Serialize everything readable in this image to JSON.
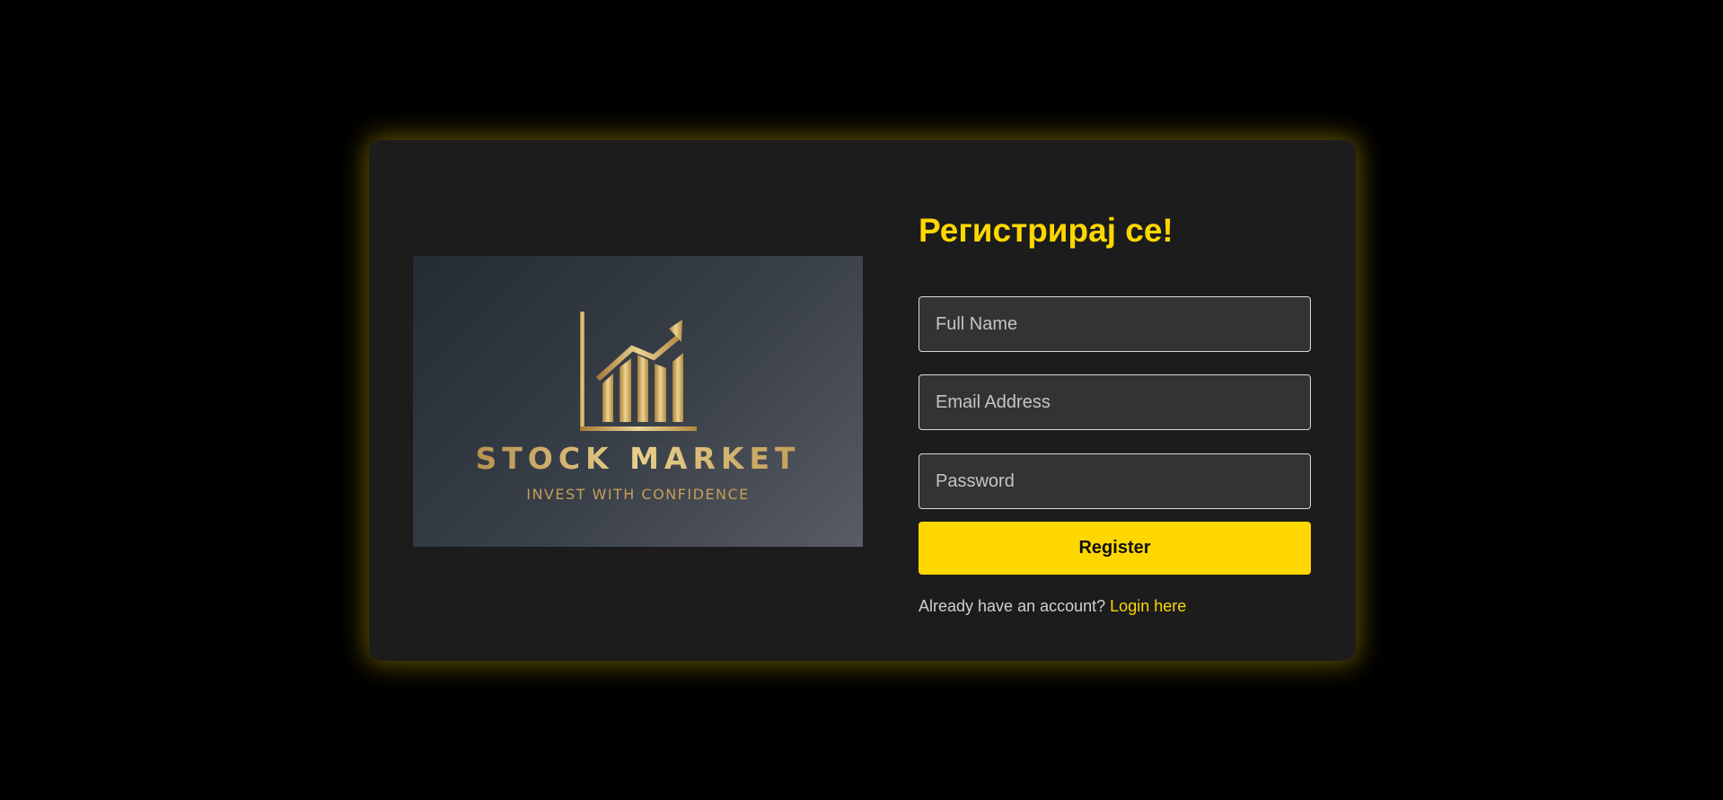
{
  "logo": {
    "title": "STOCK MARKET",
    "tagline": "INVEST WITH CONFIDENCE",
    "icon": "rising-bar-chart-icon",
    "gold_color": "#d4b06a"
  },
  "form": {
    "title": "Регистрирај се!",
    "full_name_placeholder": "Full Name",
    "email_placeholder": "Email Address",
    "password_placeholder": "Password",
    "register_label": "Register",
    "login_prompt": "Already have an account?",
    "login_link": "Login here"
  },
  "colors": {
    "accent": "#ffd700",
    "background": "#000000",
    "card": "#1c1c1c",
    "input_background": "#333333"
  }
}
